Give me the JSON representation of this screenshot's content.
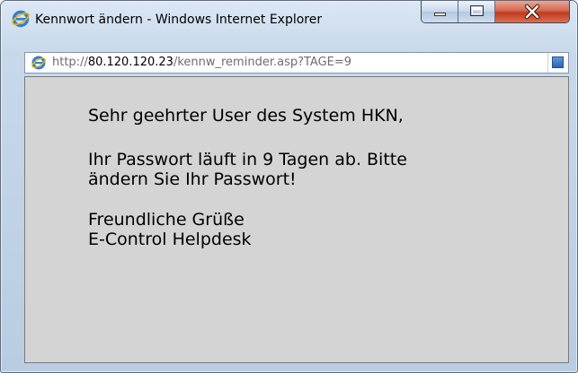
{
  "window": {
    "title": "Kennwort ändern - Windows Internet Explorer",
    "buttons": {
      "minimize": "minimize-button",
      "maximize": "maximize-button",
      "close": "close-button"
    },
    "icons": {
      "app": "internet-explorer-icon",
      "close": "close-x-icon"
    }
  },
  "addressbar": {
    "prefix": "http://",
    "host": "80.120.120.23",
    "path": "/kennw_reminder.asp?TAGE=9",
    "right_icon": "compatibility-view-icon"
  },
  "content": {
    "greeting": "Sehr geehrter User des System HKN,",
    "body_line1": "Ihr Passwort läuft in 9 Tagen ab. Bitte",
    "body_line2": "ändern Sie Ihr Passwort!",
    "closing": "Freundliche Grüße",
    "signature": "E-Control Helpdesk"
  },
  "colors": {
    "content_bg": "#d4d4d4",
    "frame_bg": "#c8d8ea",
    "close_button": "#c2391f"
  }
}
